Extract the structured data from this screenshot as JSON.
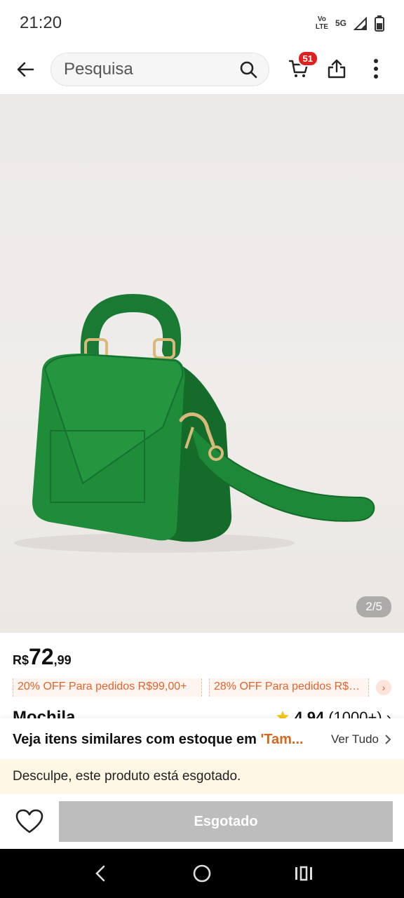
{
  "status_bar": {
    "time": "21:20",
    "volte": "Vo\nLTE",
    "network": "5G"
  },
  "top_bar": {
    "search_placeholder": "Pesquisa",
    "cart_count": "51"
  },
  "product": {
    "image_counter": "2/5",
    "price": {
      "currency": "R$",
      "integer": "72",
      "decimal": ",99"
    },
    "coupons": [
      "20% OFF Para pedidos R$99,00+",
      "28% OFF Para pedidos R$1..."
    ],
    "title": "Mochila",
    "rating": {
      "value": "4.94",
      "count": "(1000+)"
    },
    "colors": {
      "bag": "#1f8c3a",
      "bag_dark": "#146b2a",
      "hardware": "#d9b97a"
    }
  },
  "similar": {
    "text": "Veja itens similares com estoque em ",
    "highlight": "'Tam...",
    "see_all": "Ver Tudo"
  },
  "notice": {
    "text": "Desculpe, este produto está esgotado."
  },
  "bottom": {
    "soldout_label": "Esgotado"
  },
  "colors": {
    "accent": "#e6622c",
    "badge": "#e02020",
    "disabled": "#bdbdbd",
    "notice_bg": "#fff7e6"
  }
}
